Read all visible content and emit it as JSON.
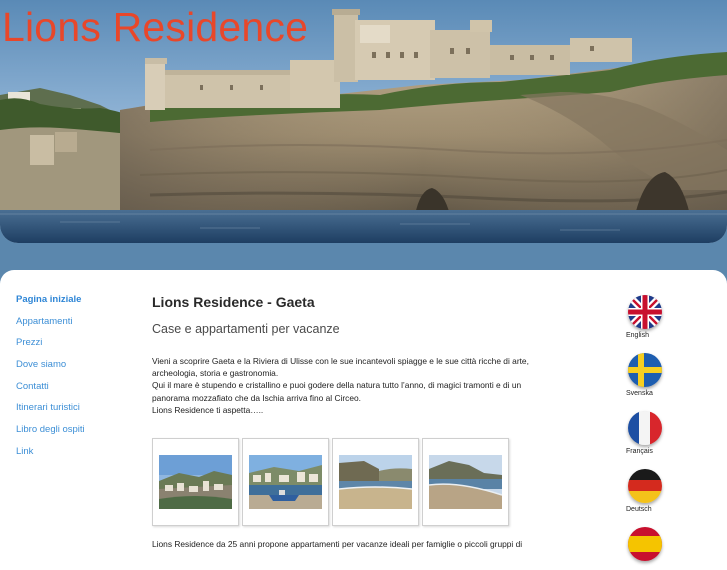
{
  "header": {
    "site_title": "Lions Residence"
  },
  "nav": {
    "items": [
      {
        "label": "Pagina iniziale",
        "active": true
      },
      {
        "label": "Appartamenti"
      },
      {
        "label": "Prezzi"
      },
      {
        "label": "Dove siamo"
      },
      {
        "label": "Contatti"
      },
      {
        "label": "Itinerari turistici"
      },
      {
        "label": "Libro degli ospiti"
      },
      {
        "label": "Link"
      }
    ]
  },
  "main": {
    "title": "Lions Residence - Gaeta",
    "subtitle": "Case e appartamenti per vacanze",
    "intro_lines": [
      "Vieni a scoprire Gaeta e la Riviera di Ulisse con le sue incantevoli spiagge e  le sue città ricche di arte,",
      "archeologia, storia e gastronomia.",
      "Qui il mare è stupendo e cristallino e puoi  godere della natura  tutto l’anno, di magici tramonti e  di un",
      "panorama mozzafiato che da Ischia arriva fino al Circeo.",
      "Lions Residence ti aspetta….."
    ],
    "bottom_text": "Lions Residence da 25 anni propone appartamenti per vacanze ideali per famiglie o piccoli gruppi di"
  },
  "gallery": {
    "photos": [
      "town-view-photo",
      "harbor-boats-photo",
      "beach-cliff-photo",
      "beach-bay-photo"
    ]
  },
  "languages": [
    {
      "label": "English",
      "icon": "uk-flag-icon"
    },
    {
      "label": "Svenska",
      "icon": "sweden-flag-icon"
    },
    {
      "label": "Français",
      "icon": "france-flag-icon"
    },
    {
      "label": "Deutsch",
      "icon": "germany-flag-icon"
    },
    {
      "label": "",
      "icon": "spain-flag-icon"
    }
  ],
  "colors": {
    "title_accent": "#e8472a",
    "nav_link": "#3d8fd6",
    "page_background": "#5b87ad"
  }
}
